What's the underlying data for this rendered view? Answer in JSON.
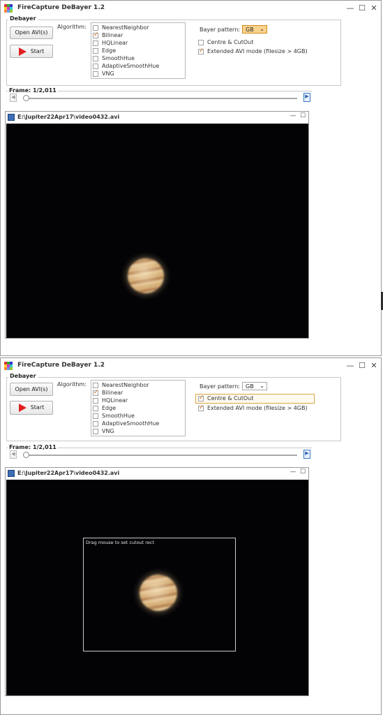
{
  "app": {
    "title": "FireCapture DeBayer 1.2",
    "window_controls": {
      "minimize": "—",
      "maximize": "☐",
      "close": "✕"
    }
  },
  "debayer": {
    "group_title": "Debayer",
    "open_button": "Open AVI(s)",
    "start_button": "Start",
    "algorithm_label": "Algorithm:",
    "algorithms": [
      {
        "label": "NearestNeighbor",
        "checked": false
      },
      {
        "label": "Bilinear",
        "checked": true
      },
      {
        "label": "HQLinear",
        "checked": false
      },
      {
        "label": "Edge",
        "checked": false
      },
      {
        "label": "SmoothHue",
        "checked": false
      },
      {
        "label": "AdaptiveSmoothHue",
        "checked": false
      },
      {
        "label": "VNG",
        "checked": false
      }
    ],
    "bayer_label": "Bayer pattern:",
    "bayer_value": "GB",
    "centre_cutout": {
      "label": "Centre & CutOut",
      "checked_top": false,
      "checked_bottom": true
    },
    "extended_avi": {
      "label": "Extended AVI mode (filesize > 4GB)",
      "checked": true
    }
  },
  "frame": {
    "label": "Frame: 1/2,011",
    "prev_icon": "◀",
    "next_icon": "▶"
  },
  "video": {
    "filename": "E:\\Jupiter22Apr17\\video0432.avi",
    "controls": {
      "minimize": "—",
      "maximize": "☐"
    },
    "cutout_hint": "Drag mouse to set cutout rect"
  },
  "colors": {
    "accent_orange": "#d06a10",
    "start_red": "#e02020",
    "selected_bayer": "#f9d38d",
    "video_bg": "#030306"
  }
}
